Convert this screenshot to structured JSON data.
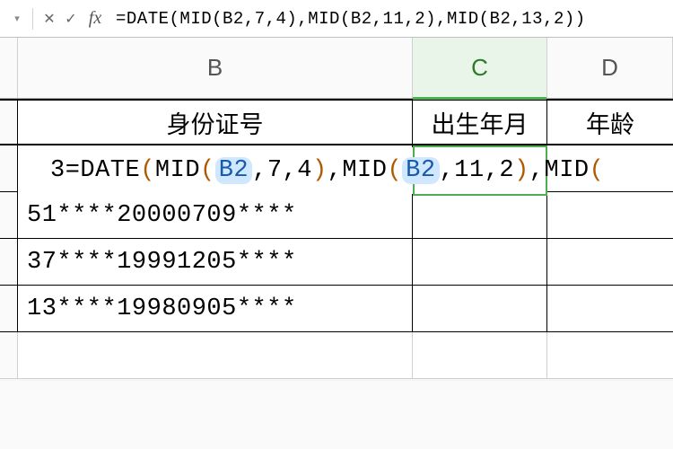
{
  "formulaBar": {
    "formula": "=DATE(MID(B2,7,4),MID(B2,11,2),MID(B2,13,2))"
  },
  "columns": {
    "B": "B",
    "C": "C",
    "D": "D"
  },
  "headers": {
    "B": "身份证号",
    "C": "出生年月",
    "D": "年龄"
  },
  "editingCell": {
    "prefix": "3",
    "eq": "=",
    "fn": "DATE",
    "op": "(",
    "mid1": "MID",
    "op1": "(",
    "ref1": "B2",
    "c1": ",",
    "n1": "7",
    "c2": ",",
    "n2": "4",
    "cp1": ")",
    "c3": ",",
    "mid2": "MID",
    "op2": "(",
    "ref2": "B2",
    "c4": ",",
    "n3": "11",
    "c5": ",",
    "n4": "2",
    "cp2": ")",
    "c6": ",",
    "mid3": "MID",
    "op3": "("
  },
  "rows": [
    "51****20000709****",
    "37****19991205****",
    "13****19980905****"
  ]
}
